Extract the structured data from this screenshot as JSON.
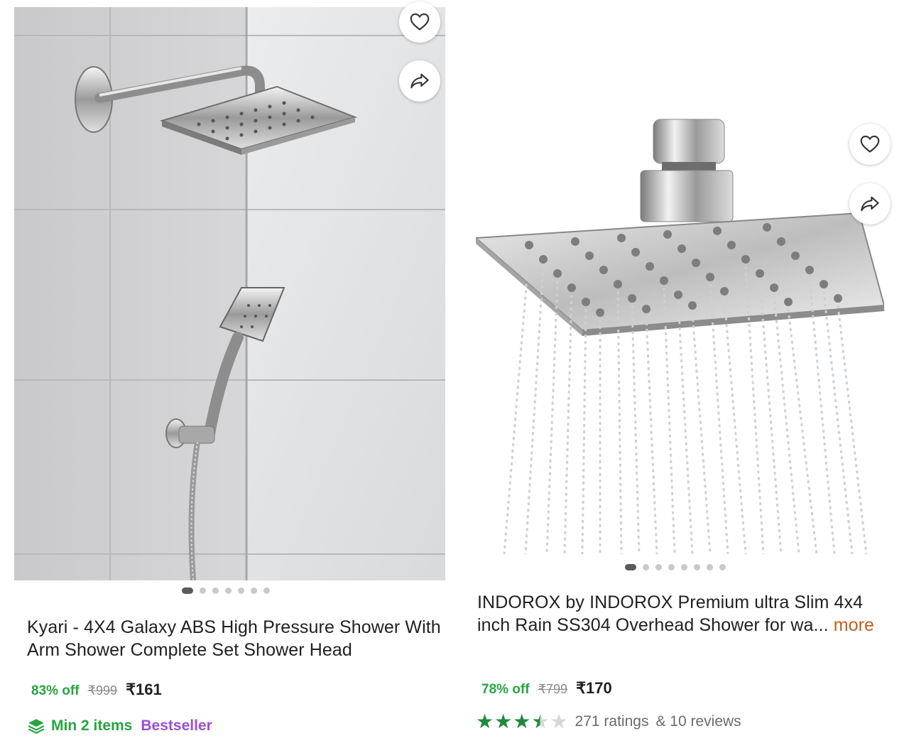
{
  "products": [
    {
      "title": "Kyari - 4X4 Galaxy ABS High Pressure Shower With Arm Shower Complete Set Shower Head",
      "discount": "83% off",
      "mrp": "₹999",
      "price": "₹161",
      "min_items": "Min 2 items",
      "badge": "Bestseller",
      "image_icon": "shower-set-photo",
      "carousel": {
        "count": 7,
        "active": 1
      }
    },
    {
      "title": "INDOROX by INDOROX Premium ultra Slim 4x4 inch Rain SS304 Overhead Shower for wa...",
      "more_label": "more",
      "discount": "78% off",
      "mrp": "₹799",
      "price": "₹170",
      "rating": 3.5,
      "ratings_text": "271 ratings",
      "reviews_text": "& 10 reviews",
      "image_icon": "rain-shower-head-photo",
      "carousel": {
        "count": 8,
        "active": 1
      }
    }
  ],
  "icons": {
    "wishlist": "heart-icon",
    "share": "share-icon",
    "min_items": "layers-icon"
  },
  "colors": {
    "discount": "#26a541",
    "bestseller": "#9b4fd6",
    "more_link": "#c25e1a",
    "star": "#1f8a3a"
  }
}
